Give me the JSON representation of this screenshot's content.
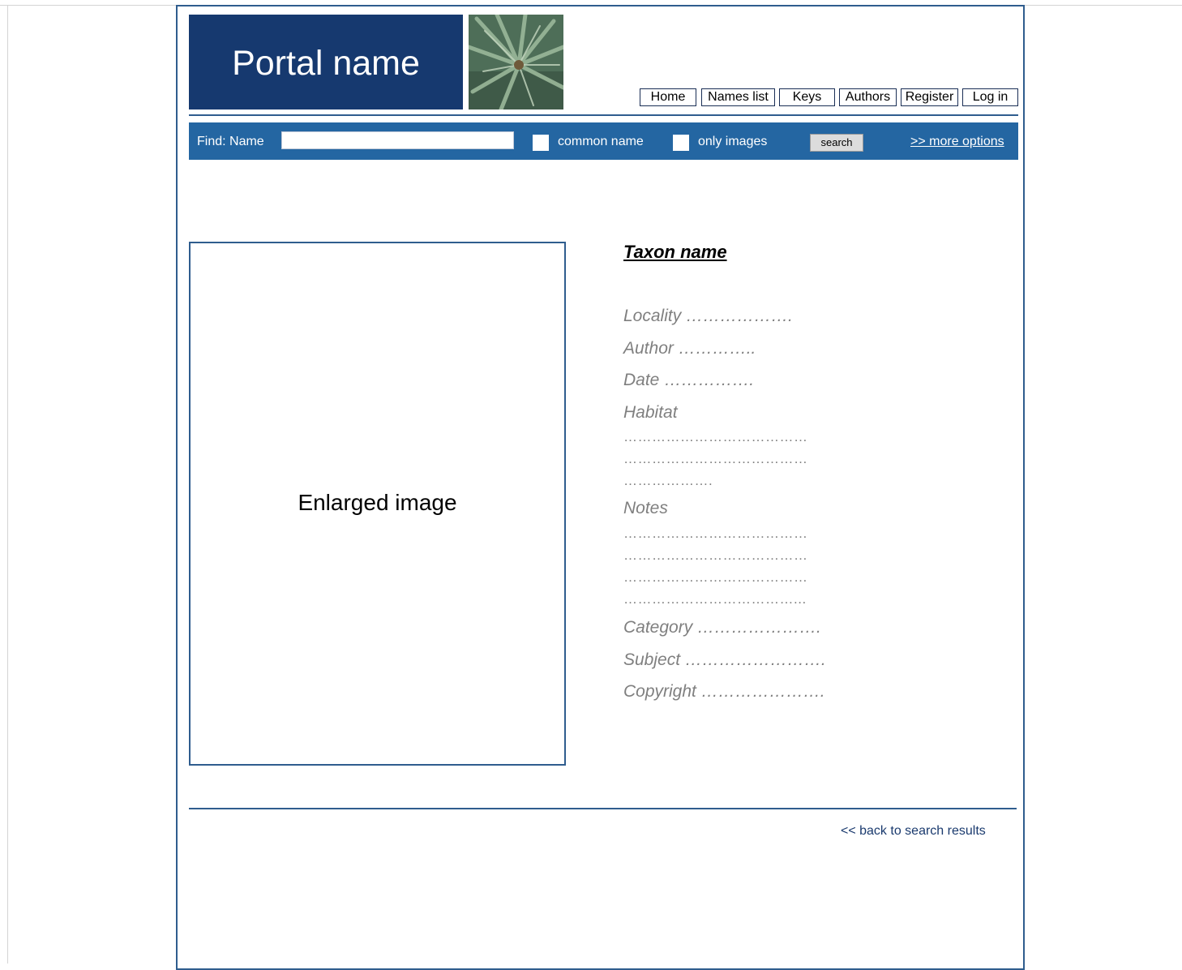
{
  "header": {
    "portal_name": "Portal name",
    "nav": [
      "Home",
      "Names list",
      "Keys",
      "Authors",
      "Register",
      "Log in"
    ]
  },
  "search": {
    "find_label": "Find:  Name",
    "name_value": "",
    "common_name_label": "common name",
    "only_images_label": "only images",
    "search_button": "search",
    "more_options": ">> more options"
  },
  "main": {
    "image_placeholder": "Enlarged image",
    "taxon_name": "Taxon name",
    "fields": {
      "locality": "Locality ……………….",
      "author": "Author …………..",
      "date": "Date …………….",
      "habitat": "Habitat",
      "habitat_lines": [
        "…………………………………",
        "…………………………………",
        "………………."
      ],
      "notes": "Notes",
      "notes_lines": [
        "…………………………………",
        "…………………………………",
        "…………………………………",
        "………………………………..."
      ],
      "category": "Category ………………….",
      "subject": "Subject …………………….",
      "copyright": "Copyright …………………."
    }
  },
  "footer": {
    "back_link": "<<  back to search results"
  }
}
